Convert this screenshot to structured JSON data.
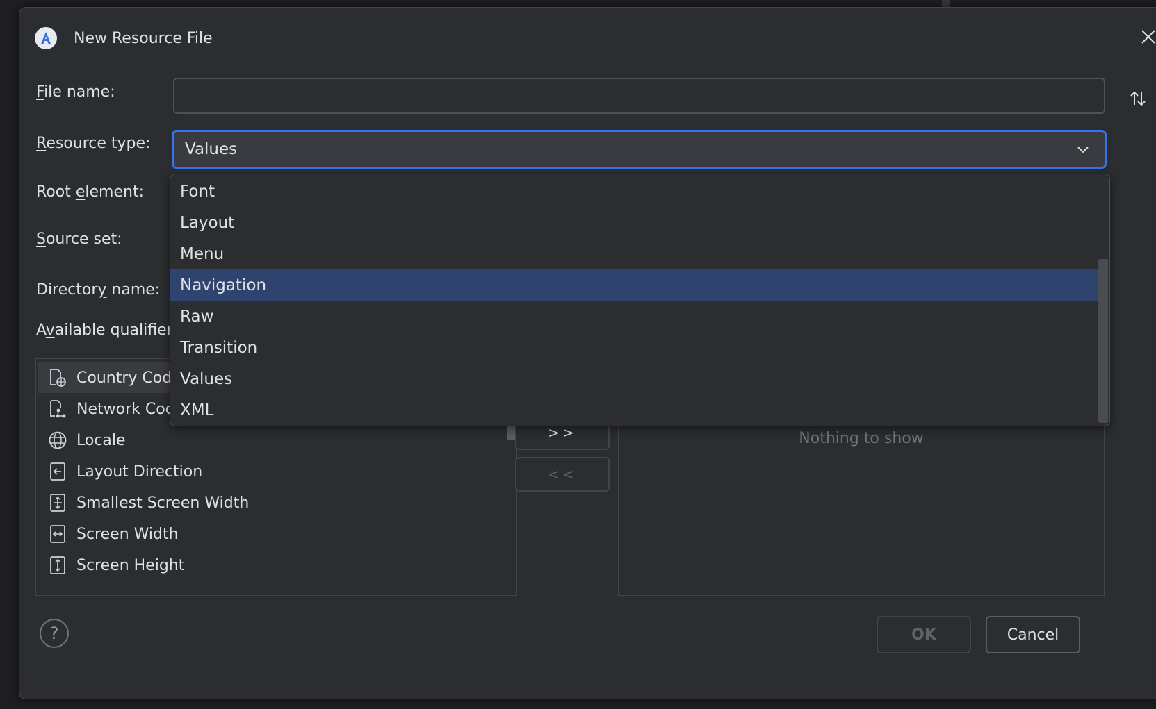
{
  "dialog": {
    "title": "New Resource File"
  },
  "form": {
    "file_name": {
      "label_first": "F",
      "label_rest": "ile name:",
      "value": ""
    },
    "resource_type": {
      "label_first": "R",
      "label_rest": "esource type:",
      "selected": "Values"
    },
    "root_element": {
      "label_pre": "Root ",
      "label_u": "e",
      "label_post": "lement:"
    },
    "source_set": {
      "label_first": "S",
      "label_rest": "ource set:"
    },
    "directory_name": {
      "label_pre": "Director",
      "label_u": "y",
      "label_post": " name:"
    },
    "available_qualifiers": {
      "label_pre": "A",
      "label_u": "v",
      "label_post": "ailable qualifier"
    }
  },
  "dropdown": {
    "options": [
      "Font",
      "Layout",
      "Menu",
      "Navigation",
      "Raw",
      "Transition",
      "Values",
      "XML"
    ],
    "highlighted": "Navigation"
  },
  "qualifiers": [
    {
      "label": "Country Cod",
      "icon": "country-code-icon"
    },
    {
      "label": "Network Coc",
      "icon": "network-code-icon"
    },
    {
      "label": "Locale",
      "icon": "globe-icon"
    },
    {
      "label": "Layout Direction",
      "icon": "layout-direction-icon"
    },
    {
      "label": "Smallest Screen Width",
      "icon": "smallest-screen-width-icon"
    },
    {
      "label": "Screen Width",
      "icon": "screen-width-icon"
    },
    {
      "label": "Screen Height",
      "icon": "screen-height-icon"
    }
  ],
  "transfer": {
    "add_label": ">>",
    "remove_label": "<<"
  },
  "chosen": {
    "empty_text": "Nothing to show"
  },
  "footer": {
    "help": "?",
    "ok": "OK",
    "cancel": "Cancel"
  },
  "colors": {
    "accent": "#3574f0",
    "selection": "#2e436e",
    "background": "#2b2d30"
  }
}
